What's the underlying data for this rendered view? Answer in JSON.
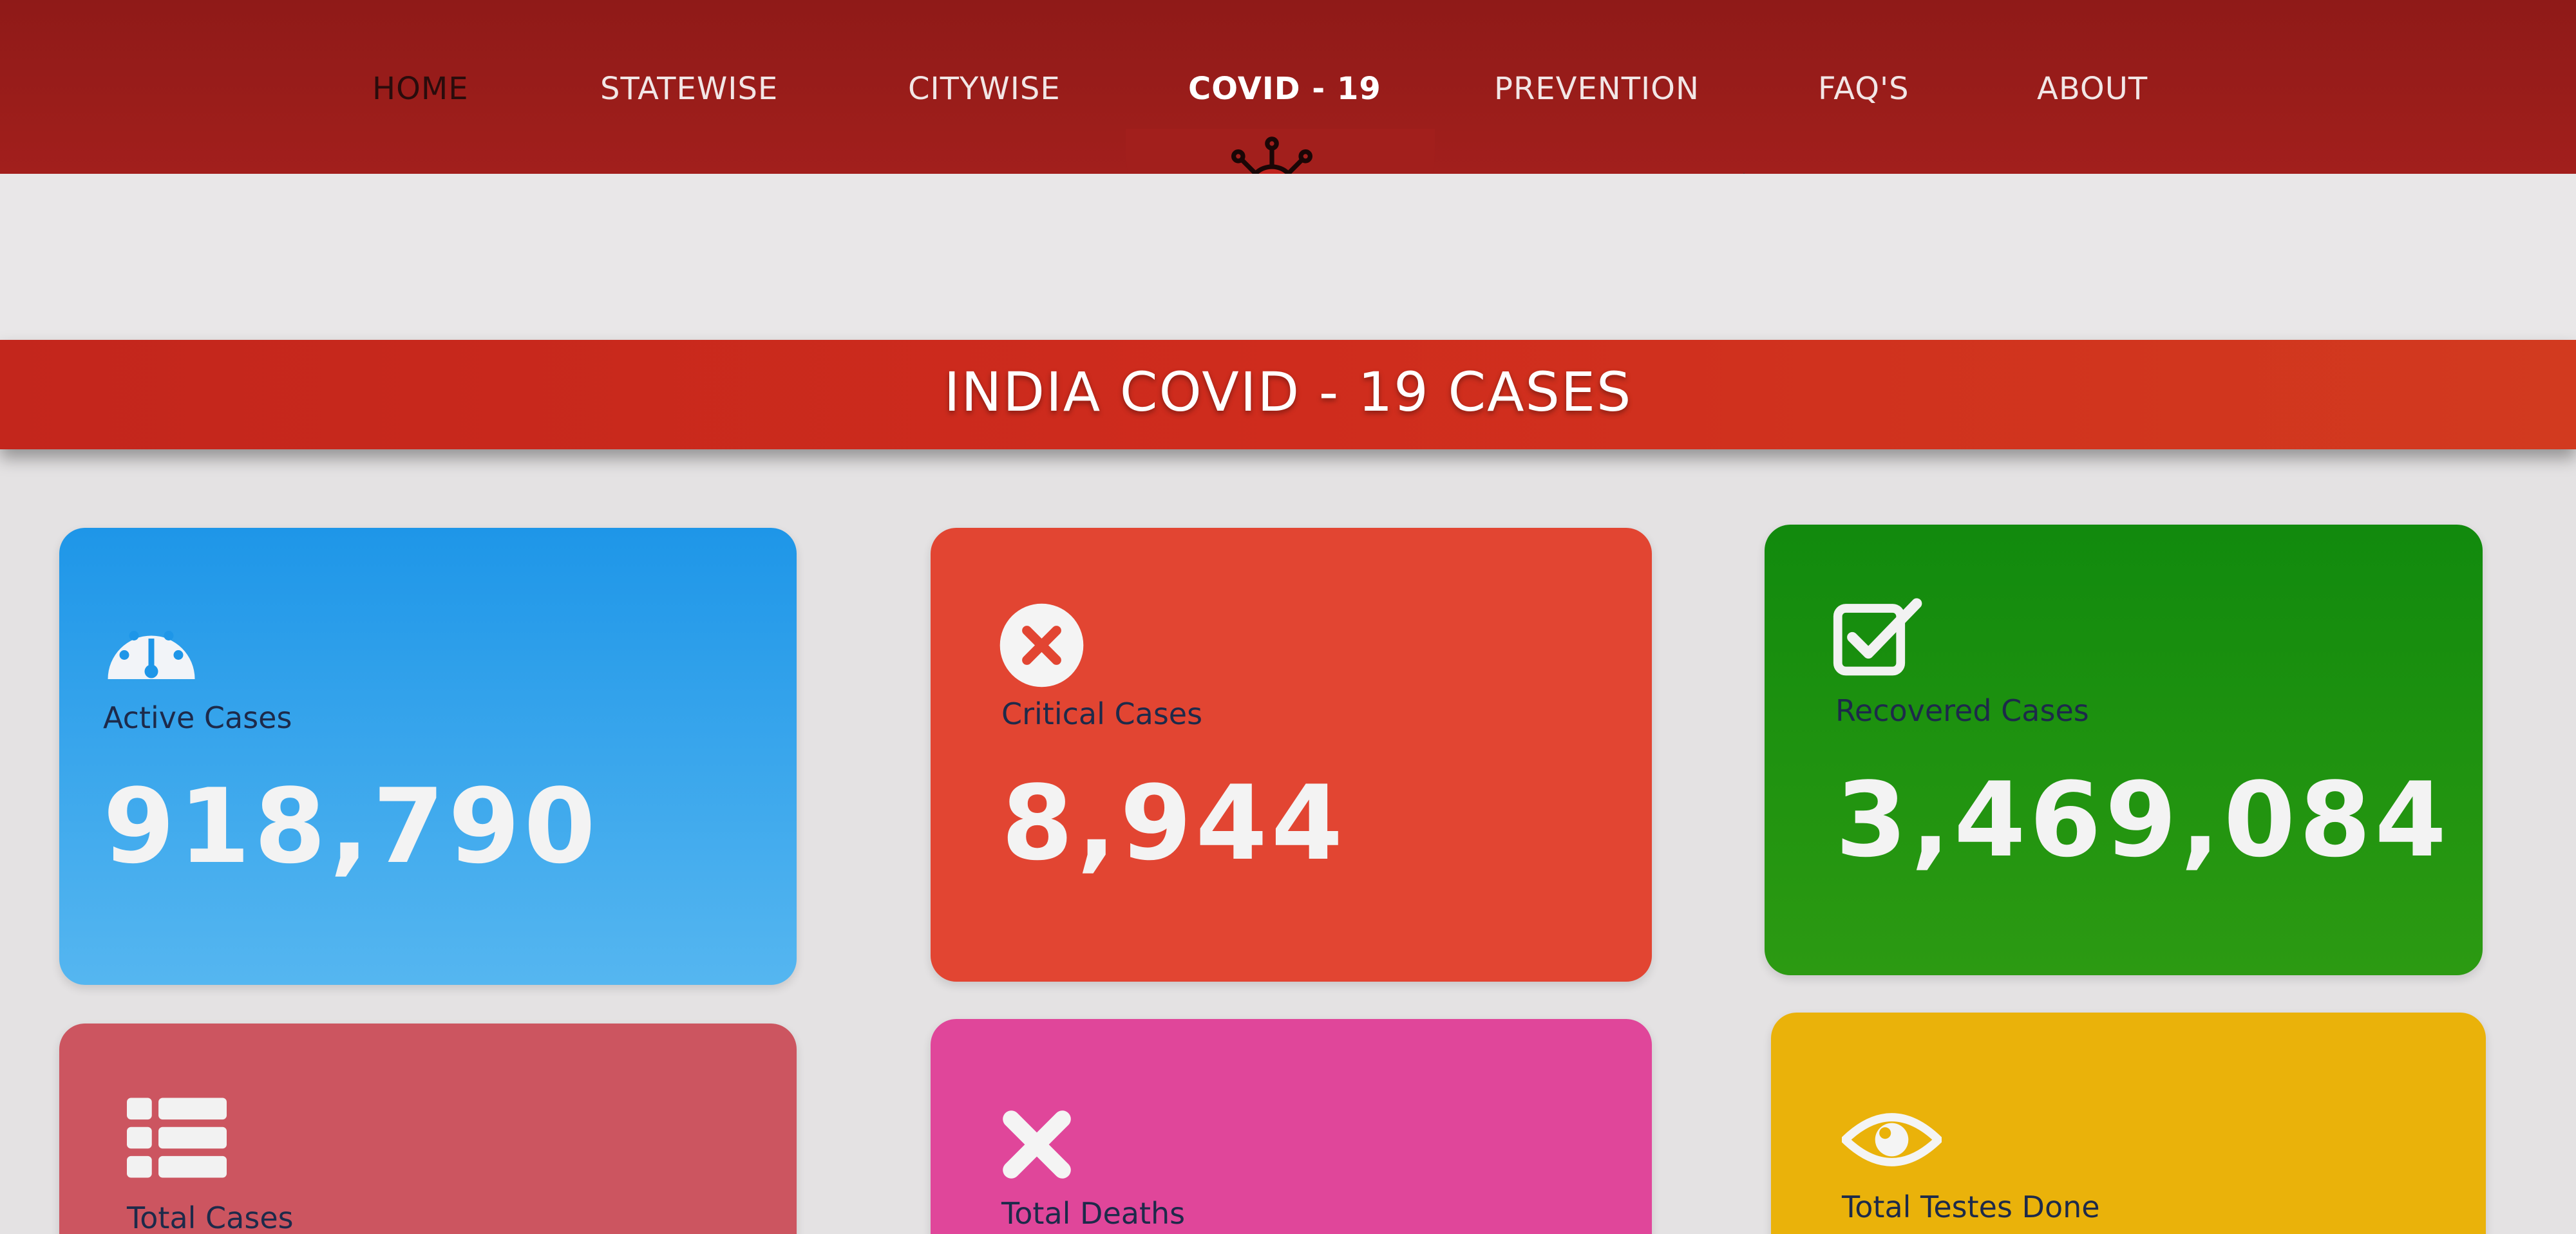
{
  "nav": {
    "items": [
      {
        "label": "HOME"
      },
      {
        "label": "STATEWISE"
      },
      {
        "label": "CITYWISE"
      },
      {
        "label": "COVID - 19"
      },
      {
        "label": "PREVENTION"
      },
      {
        "label": "FAQ'S"
      },
      {
        "label": "ABOUT"
      }
    ],
    "active_index": 3,
    "center_icon": "virus-icon"
  },
  "banner": {
    "title": "INDIA COVID - 19 CASES"
  },
  "cards": [
    {
      "label": "Active Cases",
      "value": "918,790",
      "icon": "speedometer-icon",
      "color": "#1e96e8"
    },
    {
      "label": "Critical Cases",
      "value": "8,944",
      "icon": "close-circle-icon",
      "color": "#e24532"
    },
    {
      "label": "Recovered Cases",
      "value": "3,469,084",
      "icon": "checkbox-icon",
      "color": "#118a0d"
    },
    {
      "label": "Total Cases",
      "value": "",
      "icon": "list-icon",
      "color": "#cc5560"
    },
    {
      "label": "Total Deaths",
      "value": "",
      "icon": "x-icon",
      "color": "#e0469a"
    },
    {
      "label": "Total Testes Done",
      "value": "",
      "icon": "eye-icon",
      "color": "#eab20a"
    }
  ],
  "colors": {
    "nav_bg": "#a21f1c",
    "banner_bg": "#cf2c1d",
    "page_bg": "#e4e2e3"
  }
}
